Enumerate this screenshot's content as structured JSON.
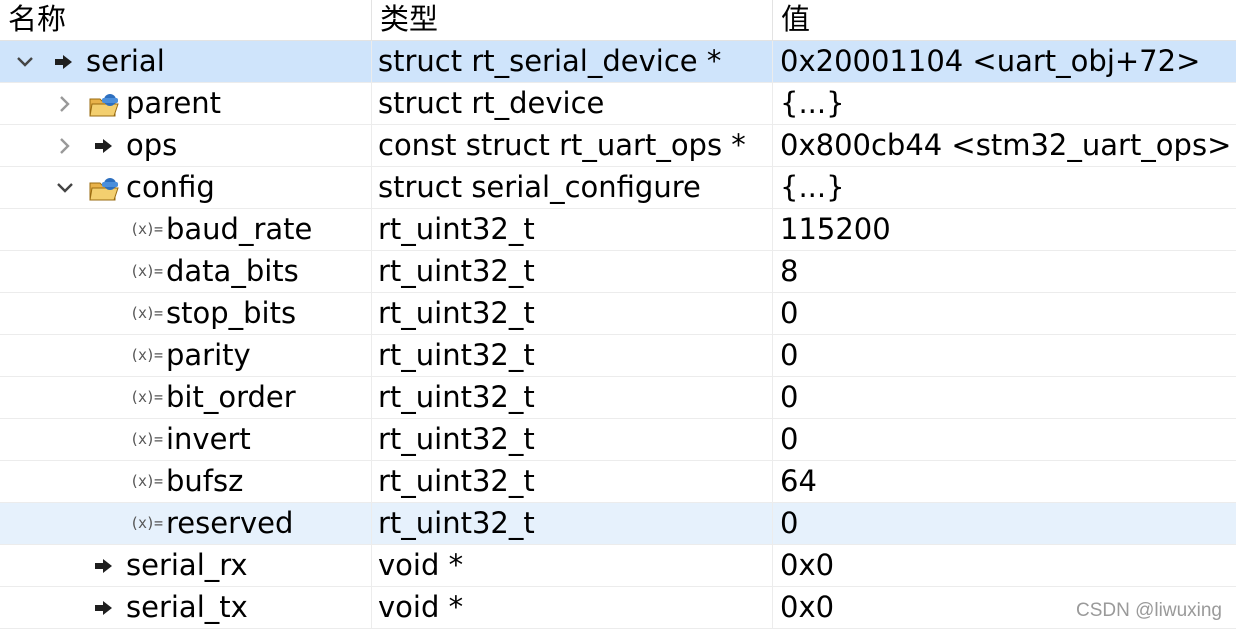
{
  "columns": {
    "name": "名称",
    "type": "类型",
    "value": "值"
  },
  "rows": [
    {
      "name": "serial",
      "type": "struct rt_serial_device *",
      "value": "0x20001104 <uart_obj+72>"
    },
    {
      "name": "parent",
      "type": "struct rt_device",
      "value": "{...}"
    },
    {
      "name": "ops",
      "type": "const struct rt_uart_ops *",
      "value": "0x800cb44 <stm32_uart_ops>"
    },
    {
      "name": "config",
      "type": "struct serial_configure",
      "value": "{...}"
    },
    {
      "name": "baud_rate",
      "type": "rt_uint32_t",
      "value": "115200"
    },
    {
      "name": "data_bits",
      "type": "rt_uint32_t",
      "value": "8"
    },
    {
      "name": "stop_bits",
      "type": "rt_uint32_t",
      "value": "0"
    },
    {
      "name": "parity",
      "type": "rt_uint32_t",
      "value": "0"
    },
    {
      "name": "bit_order",
      "type": "rt_uint32_t",
      "value": "0"
    },
    {
      "name": "invert",
      "type": "rt_uint32_t",
      "value": "0"
    },
    {
      "name": "bufsz",
      "type": "rt_uint32_t",
      "value": "64"
    },
    {
      "name": "reserved",
      "type": "rt_uint32_t",
      "value": "0"
    },
    {
      "name": "serial_rx",
      "type": "void *",
      "value": "0x0"
    },
    {
      "name": "serial_tx",
      "type": "void *",
      "value": "0x0"
    }
  ],
  "icons": {
    "expanded": "chevron-down-icon",
    "collapsed": "chevron-right-icon",
    "pointer": "pointer-arrow-icon",
    "struct": "struct-folder-icon",
    "variable": "variable-icon"
  },
  "variable_icon_text": "(x)=",
  "colors": {
    "selected_row": "#cfe4fb",
    "hover_row": "#e6f1fc",
    "grid": "#ececec"
  },
  "watermark": "CSDN @liwuxing"
}
